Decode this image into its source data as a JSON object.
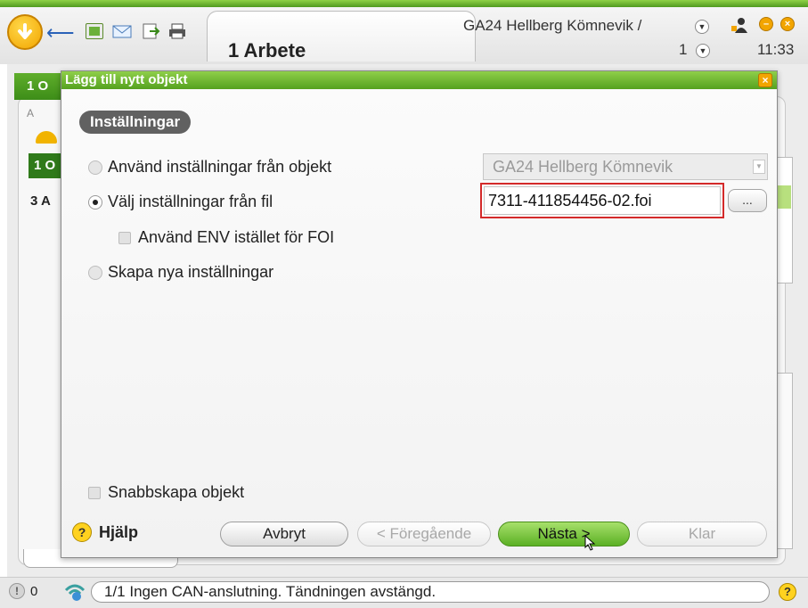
{
  "app": {
    "title": "1 Arbete",
    "connection_title": "GA24 Hellberg Kömnevik /",
    "page_number": "1",
    "clock": "11:33"
  },
  "background": {
    "left_header": "1 O",
    "tabs_hint": "A",
    "row1": "1 O",
    "row3": "3 A"
  },
  "dialog": {
    "title": "Lägg till nytt objekt",
    "close_label": "×",
    "section_label": "Inställningar",
    "options": {
      "from_object": "Använd inställningar från objekt",
      "from_file": "Välj inställningar från fil",
      "use_env": "Använd ENV istället för FOI",
      "create_new": "Skapa nya inställningar"
    },
    "object_combo_value": "GA24 Hellberg Kömnevik",
    "file_value": "7311-411854456-02.foi",
    "browse_label": "...",
    "quick_create": "Snabbskapa objekt",
    "help_label": "Hjälp",
    "buttons": {
      "cancel": "Avbryt",
      "previous": "< Föregående",
      "next": "Nästa >",
      "finish": "Klar"
    }
  },
  "statusbar": {
    "warning_count": "0",
    "message": "1/1 Ingen CAN-anslutning. Tändningen avstängd."
  },
  "colors": {
    "accent_green": "#5bb024",
    "highlight_red": "#d42a2a",
    "help_yellow": "#ffd21f"
  }
}
